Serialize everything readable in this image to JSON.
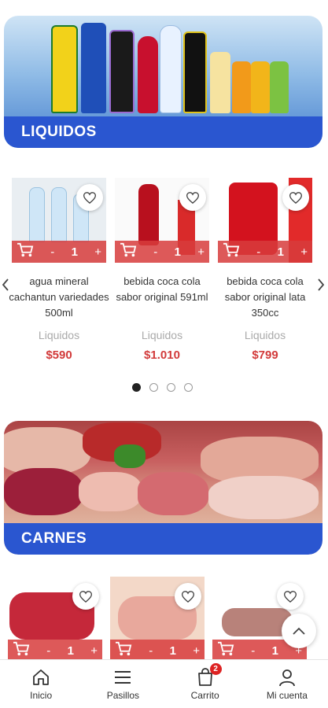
{
  "banners": [
    {
      "label": "LIQUIDOS"
    },
    {
      "label": "CARNES"
    }
  ],
  "liquidos_products": [
    {
      "name": "agua mineral cachantun variedades 500ml",
      "category": "Liquidos",
      "price": "$590",
      "qty": "1"
    },
    {
      "name": "bebida coca cola sabor original 591ml",
      "category": "Liquidos",
      "price": "$1.010",
      "qty": "1"
    },
    {
      "name": "bebida coca cola sabor original lata 350cc",
      "category": "Liquidos",
      "price": "$799",
      "qty": "1"
    }
  ],
  "carnes_products": [
    {
      "qty": "1"
    },
    {
      "qty": "1"
    },
    {
      "qty": "1"
    }
  ],
  "cart_controls": {
    "minus": "-",
    "plus": "+"
  },
  "carousel": {
    "dots": 4,
    "active_dot": 0
  },
  "bottom_nav": {
    "items": [
      {
        "label": "Inicio",
        "icon": "home-icon"
      },
      {
        "label": "Pasillos",
        "icon": "menu-icon"
      },
      {
        "label": "Carrito",
        "icon": "cart-bag-icon",
        "badge": "2"
      },
      {
        "label": "Mi cuenta",
        "icon": "user-icon"
      }
    ]
  },
  "colors": {
    "brand_blue": "#2a56d0",
    "accent_red": "#d23a3a",
    "cart_bar": "#d73c3c"
  }
}
